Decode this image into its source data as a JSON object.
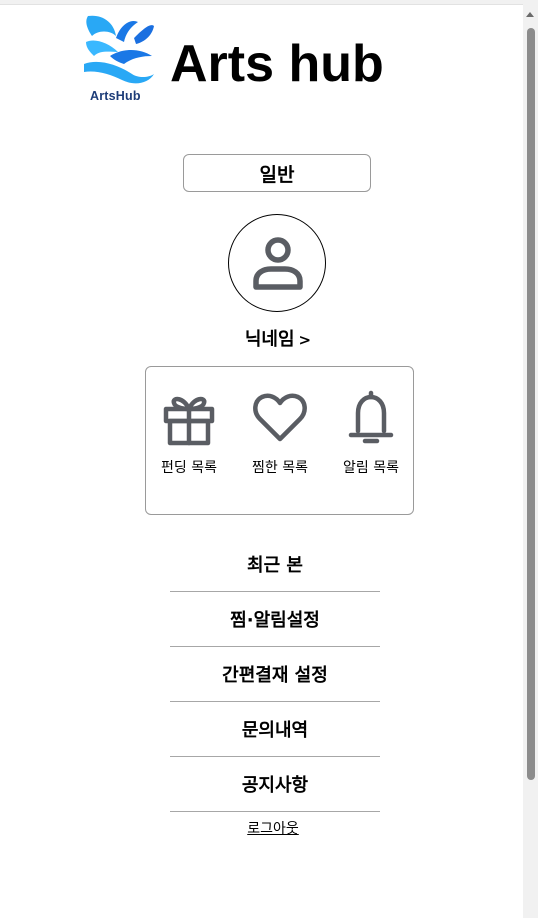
{
  "app": {
    "title": "Arts hub",
    "logo_text": "ArtsHub"
  },
  "profile": {
    "grade_label": "일반",
    "nickname": "닉네임",
    "nickname_chevron": ">"
  },
  "shortcuts": [
    {
      "label": "펀딩 목록",
      "icon": "gift-icon"
    },
    {
      "label": "찜한 목록",
      "icon": "heart-icon"
    },
    {
      "label": "알림 목록",
      "icon": "bell-icon"
    }
  ],
  "menu": {
    "items": [
      {
        "label": "최근 본"
      },
      {
        "label": "찜·알림설정"
      },
      {
        "label": "간편결재 설정"
      },
      {
        "label": "문의내역"
      },
      {
        "label": "공지사항"
      }
    ]
  },
  "logout_label": "로그아웃",
  "colors": {
    "icon": "#5a5d63",
    "logo_light": "#3ab8ff",
    "logo_dark": "#1a6fe0",
    "logo_text": "#1d3c78",
    "border": "#9a9a9a"
  }
}
